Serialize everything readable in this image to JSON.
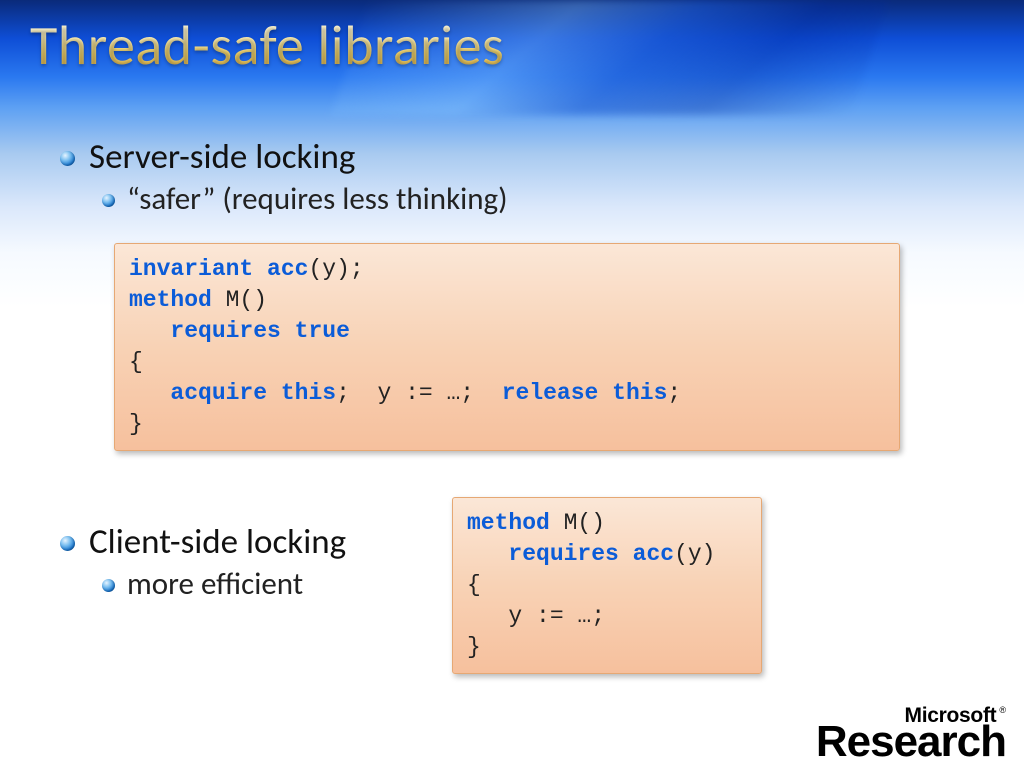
{
  "title": "Thread-safe libraries",
  "section1": {
    "heading": "Server-side locking",
    "sub": "“safer” (requires less thinking)"
  },
  "section2": {
    "heading": "Client-side locking",
    "sub": "more efficient"
  },
  "code1": {
    "l1_kw1": "invariant",
    "l1_kw2": "acc",
    "l1_rest": "(y);",
    "l2_kw": "method",
    "l2_rest": " M()",
    "l3_kw": "requires",
    "l3_kw2": "true",
    "l4": "{",
    "l5_kw1": "acquire",
    "l5_kw2": "this",
    "l5_mid": ";  y := …;  ",
    "l5_kw3": "release",
    "l5_kw4": "this",
    "l5_end": ";",
    "l6": "}"
  },
  "code2": {
    "l1_kw": "method",
    "l1_rest": " M()",
    "l2_kw1": "requires",
    "l2_kw2": "acc",
    "l2_rest": "(y)",
    "l3": "{",
    "l4": "   y := …;",
    "l5": "}"
  },
  "logo": {
    "company": "Microsoft",
    "mark": "®",
    "unit": "Research"
  }
}
